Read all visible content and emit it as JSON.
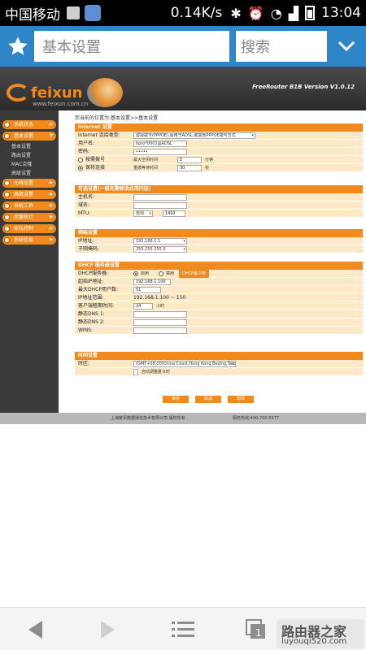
{
  "status_bar": {
    "carrier": "中国移动",
    "speed": "0.14K/s",
    "time": "13:04"
  },
  "browser": {
    "url_title": "基本设置",
    "search_label": "搜索"
  },
  "router": {
    "brand": "feixun",
    "brand_sub": "www.feixun.com.cn",
    "version": "FreeRouter B1B Version V1.0.12",
    "breadcrumb": "您当前的位置为:基本设置>>基本设置",
    "nav": {
      "items": [
        {
          "label": "系统状态"
        },
        {
          "label": "基本设置"
        },
        {
          "label": "无线设置"
        },
        {
          "label": "高级设置"
        },
        {
          "label": "系统工具"
        },
        {
          "label": "流量统计"
        },
        {
          "label": "家长控制"
        },
        {
          "label": "系统信息"
        }
      ],
      "sub_items": [
        {
          "label": "基本设置"
        },
        {
          "label": "路由设置"
        },
        {
          "label": "MAC克隆"
        },
        {
          "label": "高级设置"
        }
      ]
    },
    "internet": {
      "header": "Internet 设置",
      "conn_type_label": "Internet 连接类型:",
      "conn_type_value": "虚拟拨号(PPPOE),适用于ADSL,或其他PPPOE拨号方式",
      "account_label": "用户名:",
      "account_value": "hpro*0001@ADSL",
      "password_label": "密码:",
      "password_value": "•••••",
      "demand_label": "按需拨号",
      "demand_idle_label": "最大空闲时间",
      "demand_idle_value": "5",
      "demand_unit": "分钟",
      "keepalive_label": "保持连接",
      "redial_label": "重拨等待时间",
      "redial_value": "30",
      "redial_unit": "秒"
    },
    "optional": {
      "header": "可选设置(一般无需修改此项内容)",
      "host_label": "主机名:",
      "domain_label": "域名:",
      "mtu_label": "MTU:",
      "mtu_mode": "自动",
      "mtu_value": "1492"
    },
    "network": {
      "header": "网络设置",
      "ip_label": "IP地址:",
      "ip_value": "192.168.1.1",
      "mask_label": "子网掩码:",
      "mask_value": "255.255.255.0"
    },
    "dhcp": {
      "header": "DHCP 服务器设置",
      "server_label": "DHCP服务器:",
      "enable_label": "启用",
      "disable_label": "禁用",
      "client_list_button": "DHCP客户表",
      "start_label": "起始IP地址:",
      "start_value": "192.168.1.100",
      "max_users_label": "最大DHCP用户数:",
      "max_users_value": "51",
      "range_label": "IP地址范围:",
      "range_value": "192.168.1.100 ~ 150",
      "lease_label": "客户端租期时间:",
      "lease_value": "24",
      "lease_unit": "小时",
      "dns1_label": "静态DNS 1:",
      "dns2_label": "静态DNS 2:",
      "wins_label": "WINS:"
    },
    "time": {
      "header": "时间设置",
      "zone_label": "时区:",
      "zone_value": "(GMT+08:00)China Coast,Hong Kong,Beijing,Taipei",
      "dst_label": "自动调整夏令时"
    },
    "buttons": {
      "save": "保存",
      "cancel": "取消",
      "help": "帮助"
    },
    "footer": {
      "company": "上海斐讯数据通信技术有限公司 版权所有",
      "hotline": "服务热线:400-700-5577"
    }
  },
  "watermark": {
    "line1": "路由器之家",
    "line2": "luyouqi520.com"
  },
  "colors": {
    "accent": "#f08a1c",
    "browser_bar": "#2e86c8",
    "nav_bg": "#3a3a3a",
    "section_bg": "#fde9c8"
  }
}
